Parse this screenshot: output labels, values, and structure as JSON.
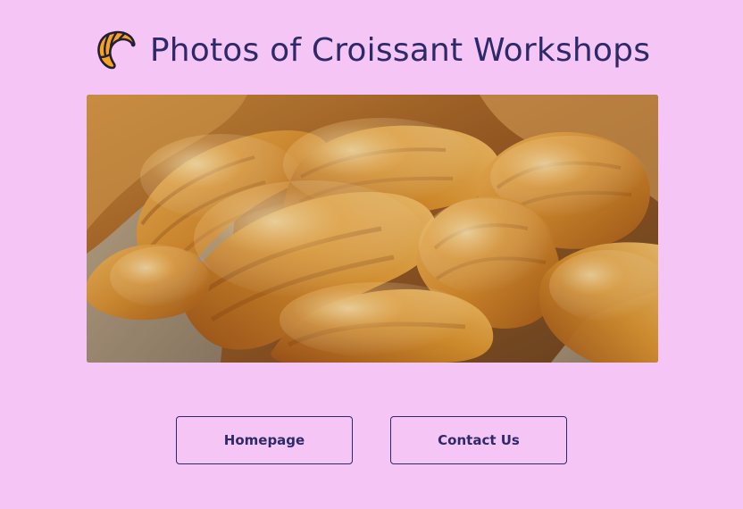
{
  "header": {
    "title": "Photos of Croissant Workshops",
    "logo_icon": "croissant-icon"
  },
  "hero": {
    "image_subject": "croissants"
  },
  "nav": {
    "homepage_label": "Homepage",
    "contact_label": "Contact Us"
  },
  "colors": {
    "background": "#f5c6f5",
    "text": "#2e2a68",
    "logo_fill": "#f4a51c"
  }
}
